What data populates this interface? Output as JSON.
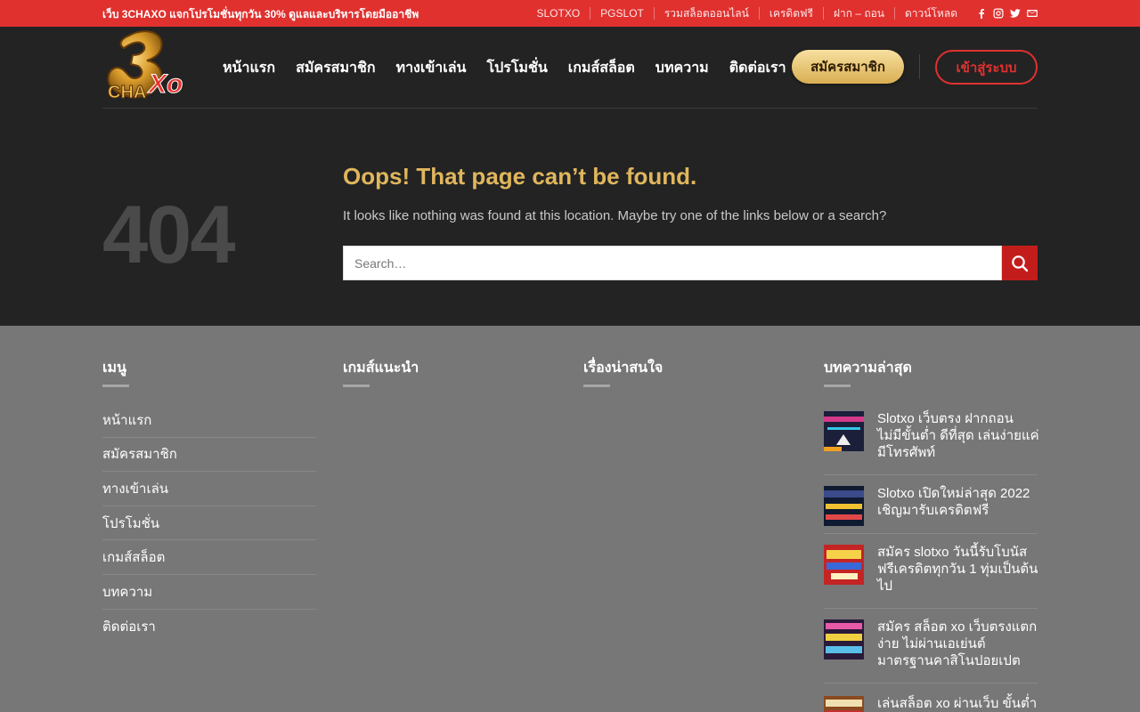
{
  "topbar": {
    "promo": "เว็บ 3CHAXO แจกโปรโมชั่นทุกวัน 30% ดูแลและบริหารโดยมืออาชีพ",
    "links": [
      "SLOTXO",
      "PGSLOT",
      "รวมสล็อตออนไลน์",
      "เครดิตฟรี",
      "ฝาก – ถอน",
      "ดาวน์โหลด"
    ],
    "socials": [
      "facebook-icon",
      "instagram-icon",
      "twitter-icon",
      "email-icon"
    ]
  },
  "header": {
    "logo_text": "3CHAXO",
    "nav": [
      "หน้าแรก",
      "สมัครสมาชิก",
      "ทางเข้าเล่น",
      "โปรโมชั่น",
      "เกมส์สล็อต",
      "บทความ",
      "ติดต่อเรา"
    ],
    "register_button": "สมัครสมาชิก",
    "login_button": "เข้าสู่ระบบ"
  },
  "error": {
    "code": "404",
    "title": "Oops! That page can’t be found.",
    "message": "It looks like nothing was found at this location. Maybe try one of the links below or a search?",
    "search_placeholder": "Search…"
  },
  "footer": {
    "menu_heading": "เมนู",
    "menu_items": [
      "หน้าแรก",
      "สมัครสมาชิก",
      "ทางเข้าเล่น",
      "โปรโมชั่น",
      "เกมส์สล็อต",
      "บทความ",
      "ติดต่อเรา"
    ],
    "games_heading": "เกมส์แนะนำ",
    "interesting_heading": "เรื่องน่าสนใจ",
    "latest_heading": "บทความล่าสุด",
    "latest_posts": [
      "Slotxo เว็บตรง ฝากถอน ไม่มีขั้นต่ำ ดีที่สุด เล่นง่ายแค่มีโทรศัพท์",
      "Slotxo เปิดใหม่ล่าสุด 2022 เชิญมารับเครดิตฟรี",
      "สมัคร slotxo วันนี้รับโบนัสฟรีเครดิตทุกวัน 1 ทุ่มเป็นต้นไป",
      "สมัคร สล็อต xo เว็บตรงแตกง่าย ไม่ผ่านเอเย่นต์ มาตรฐานคาสิโนปอยเปต",
      "เล่นสล็อต xo ผ่านเว็บ ขั้นต่ำ"
    ]
  },
  "colors": {
    "topbar": "#e0312f",
    "header_bg": "#232323",
    "accent_gold": "#e0b65d",
    "footer_bg": "#777777",
    "search_button": "#c31d1b"
  }
}
